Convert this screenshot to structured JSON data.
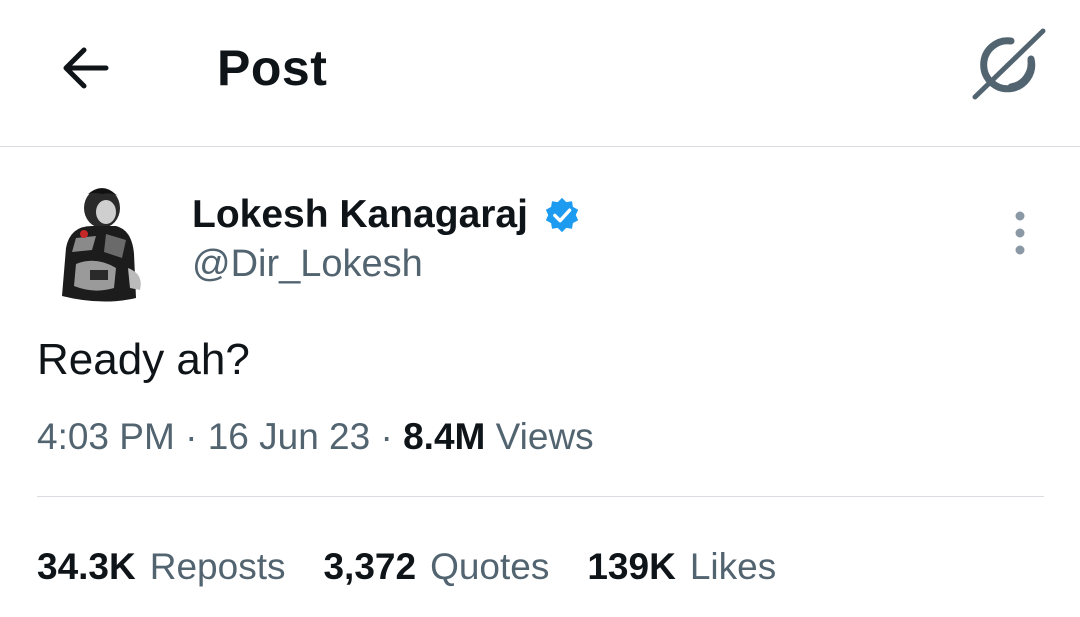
{
  "header": {
    "title": "Post",
    "back_icon": "arrow-left-icon",
    "grok_icon": "grok-icon"
  },
  "author": {
    "name": "Lokesh Kanagaraj",
    "handle": "@Dir_Lokesh",
    "verified": true,
    "verified_color": "#1d9bf0"
  },
  "tweet": {
    "text": "Ready ah?",
    "time": "4:03 PM",
    "date": "16 Jun 23",
    "views_count": "8.4M",
    "views_label": "Views",
    "separator": "·"
  },
  "stats": [
    {
      "count": "34.3K",
      "label": "Reposts"
    },
    {
      "count": "3,372",
      "label": "Quotes"
    },
    {
      "count": "139K",
      "label": "Likes"
    }
  ],
  "colors": {
    "text_primary": "#0f1419",
    "text_secondary": "#536471",
    "divider": "#d9dde1"
  }
}
